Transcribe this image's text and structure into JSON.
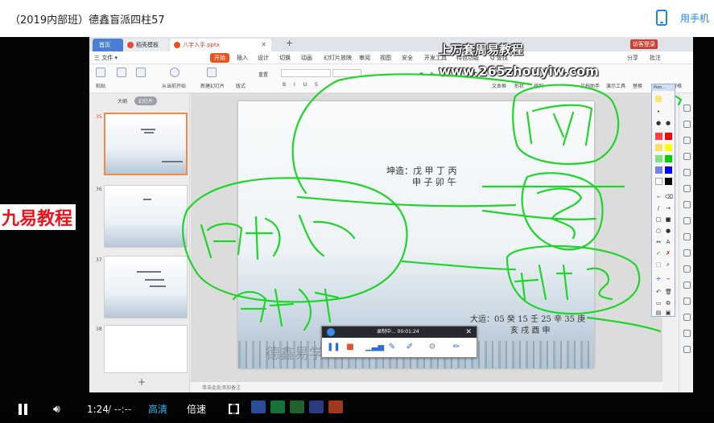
{
  "page": {
    "title": "（2019内部班）德鑫盲派四柱57",
    "phone_label": "用手机"
  },
  "wps": {
    "tabs": [
      {
        "label": "首页"
      },
      {
        "label": "稻壳模板"
      },
      {
        "label": "八字入手.pptx"
      }
    ],
    "menu": [
      {
        "label": "三 文件 ▾"
      },
      {
        "label": "开始"
      },
      {
        "label": "插入"
      },
      {
        "label": "设计"
      },
      {
        "label": "切换"
      },
      {
        "label": "动画"
      },
      {
        "label": "幻灯片放映"
      },
      {
        "label": "审阅"
      },
      {
        "label": "视图"
      },
      {
        "label": "安全"
      },
      {
        "label": "开发工具"
      },
      {
        "label": "特色功能"
      },
      {
        "label": "Q 查找"
      }
    ],
    "menu_right": {
      "share": "分享",
      "critique": "批注",
      "account": "访客登录"
    },
    "ribbon": {
      "paste": "粘贴",
      "from_current": "从当前开始",
      "new_slide": "新建幻灯片",
      "layout": "版式",
      "reset": "重置",
      "text_box": "文本框",
      "shape": "形状",
      "arrange": "排列",
      "text_tools": "文档助手",
      "present_tools": "演示工具",
      "replace": "替换",
      "select_pane": "选择窗格"
    },
    "left_panel": {
      "tab_outline": "大纲",
      "tab_slides": "幻灯片",
      "thumb_numbers": [
        "35",
        "36",
        "37",
        "38"
      ],
      "add": "+"
    },
    "slide": {
      "line1": "坤造：戊 甲 丁 丙",
      "line2": "申 子 卯 午",
      "dayun_line1": "大运：05 癸 15 壬 25 辛 35 庚",
      "dayun_line2": "亥 戌 酉 申",
      "watermark": "德鑫易学"
    },
    "notes_hint": "单击此处添加备注",
    "palette_title": "Poin…"
  },
  "watermarks": {
    "top": "上万套周易教程",
    "url": "www.265zhouyiw.com",
    "left": "九易教程"
  },
  "recorder": {
    "status": "录制中... 00:01:24",
    "close": "✕"
  },
  "player": {
    "time": "1:24",
    "separator": "/ --:--",
    "quality": "高清",
    "speed": "倍速"
  },
  "colors": {
    "ink": "#1fd52a",
    "accent": "#e8541e",
    "phone": "#1e88e5",
    "quality": "#29b6f6",
    "watermark_red": "#e8141c"
  }
}
